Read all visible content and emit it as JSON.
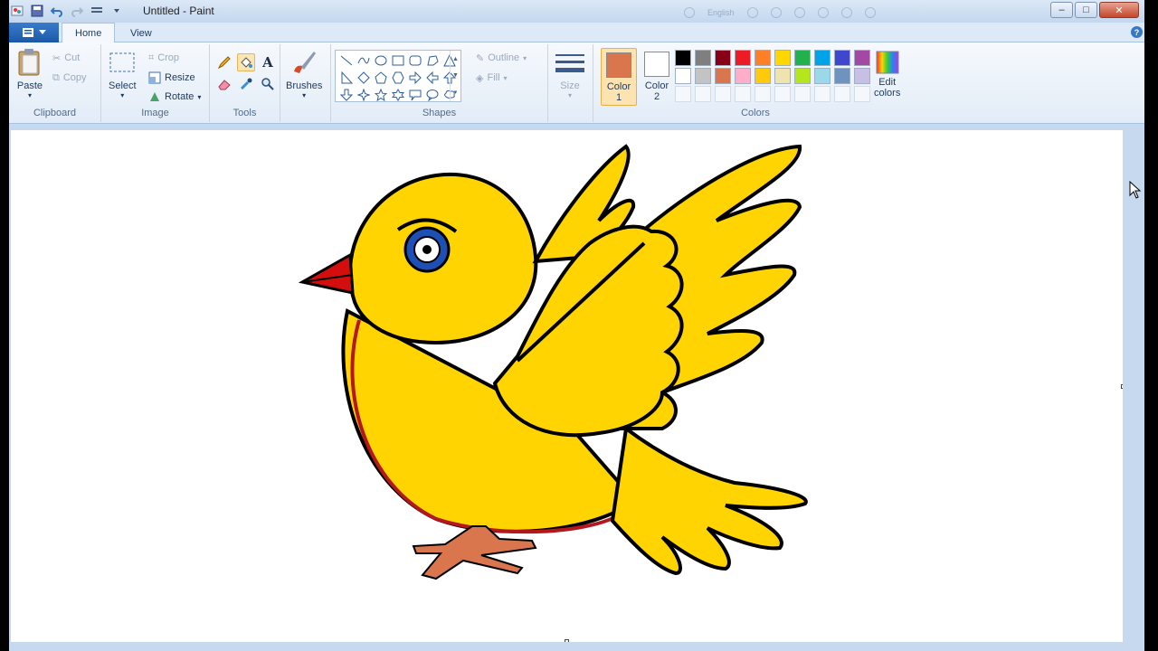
{
  "window": {
    "title": "Untitled - Paint",
    "controls": {
      "minimize": "–",
      "maximize": "□",
      "close": "✕"
    }
  },
  "ghost_overlay": {
    "language": "English"
  },
  "tabs": [
    {
      "label": "Home",
      "active": true
    },
    {
      "label": "View",
      "active": false
    }
  ],
  "ribbon": {
    "clipboard": {
      "label": "Clipboard",
      "paste": "Paste",
      "cut": "Cut",
      "copy": "Copy"
    },
    "image": {
      "label": "Image",
      "select": "Select",
      "crop": "Crop",
      "resize": "Resize",
      "rotate": "Rotate"
    },
    "tools": {
      "label": "Tools",
      "selected_tool": "fill-bucket"
    },
    "brushes": {
      "label": "Brushes"
    },
    "shapes": {
      "label": "Shapes",
      "outline": "Outline",
      "fill": "Fill"
    },
    "size": {
      "label": "Size"
    },
    "colors": {
      "label": "Colors",
      "color1_label": "Color",
      "color1_num": "1",
      "color2_label": "Color",
      "color2_num": "2",
      "color1": "#d9764e",
      "color2": "#ffffff",
      "edit_colors_line1": "Edit",
      "edit_colors_line2": "colors",
      "palette_row1": [
        "#000000",
        "#7f7f7f",
        "#880015",
        "#ed1c24",
        "#ff7f27",
        "#ffd700",
        "#22b14c",
        "#00a2e8",
        "#3f48cc",
        "#a349a4"
      ],
      "palette_row2": [
        "#ffffff",
        "#c3c3c3",
        "#d9764e",
        "#ffaec9",
        "#ffc90e",
        "#efe4b0",
        "#b5e61d",
        "#99d9ea",
        "#7092be",
        "#c8bfe7"
      ],
      "palette_row3": [
        "",
        "",
        "",
        "",
        "",
        "",
        "",
        "",
        "",
        ""
      ]
    }
  },
  "drawing": {
    "subject": "yellow-bird",
    "body_color": "#ffd400",
    "eye_color": "#1e4fb4",
    "beak_color": "#d40d0d",
    "feet_color": "#d9764e",
    "belly_outline": "#b5171e"
  }
}
